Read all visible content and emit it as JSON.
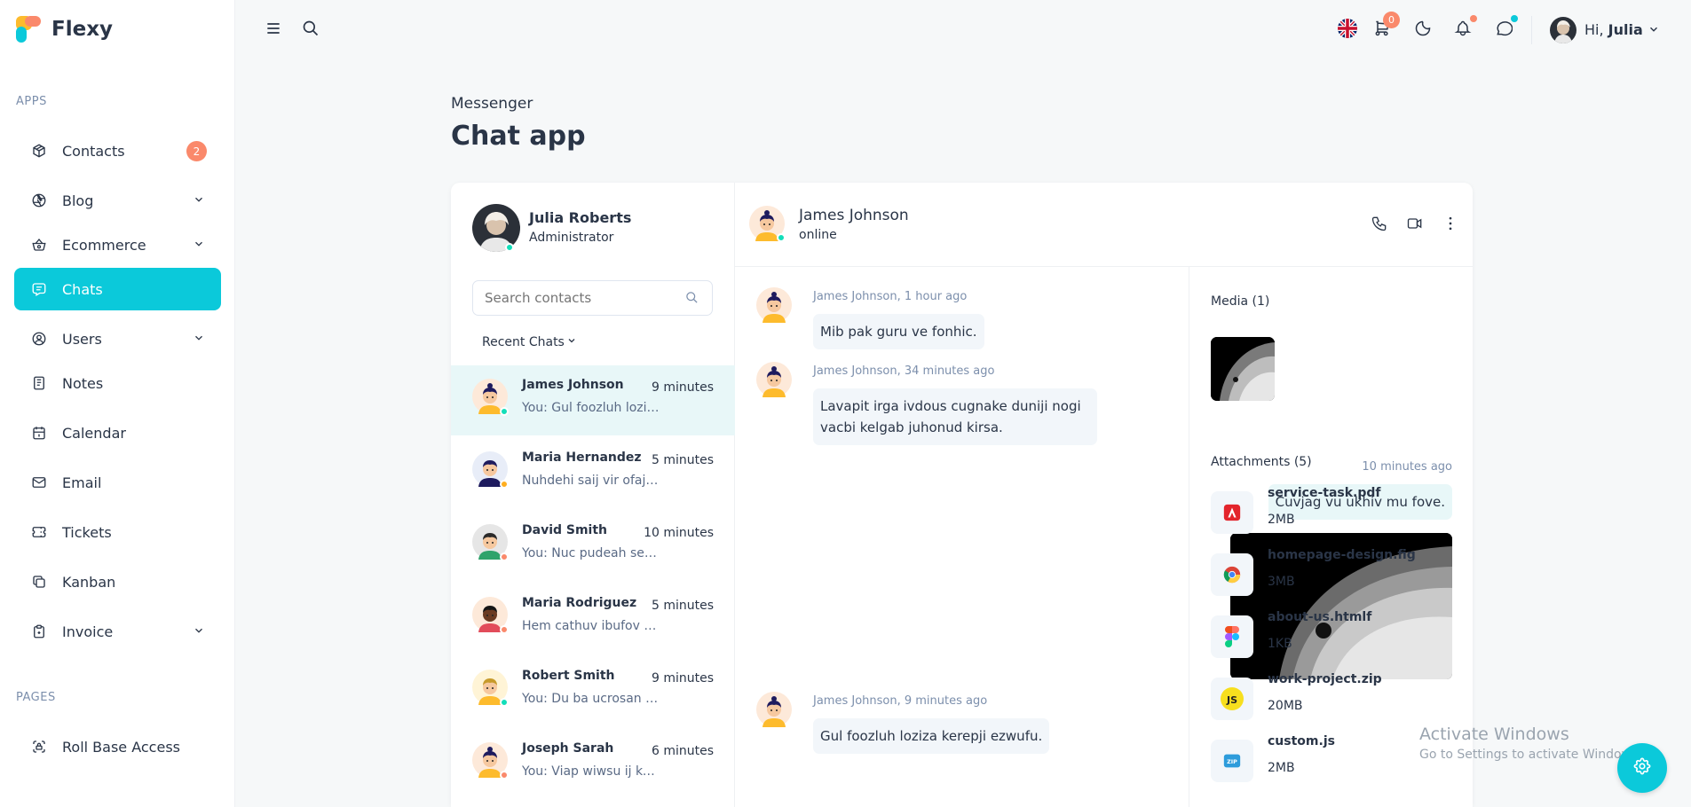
{
  "brand": {
    "name": "Flexy"
  },
  "sidebar": {
    "sections": [
      {
        "label": "APPS"
      },
      {
        "label": "PAGES"
      }
    ],
    "items": [
      {
        "label": "Contacts",
        "icon": "package-icon",
        "badge": "2"
      },
      {
        "label": "Blog",
        "icon": "aperture-icon",
        "expandable": true
      },
      {
        "label": "Ecommerce",
        "icon": "basket-icon",
        "expandable": true
      },
      {
        "label": "Chats",
        "icon": "message-icon",
        "active": true
      },
      {
        "label": "Users",
        "icon": "user-circle-icon",
        "expandable": true
      },
      {
        "label": "Notes",
        "icon": "notes-icon"
      },
      {
        "label": "Calendar",
        "icon": "calendar-icon"
      },
      {
        "label": "Email",
        "icon": "mail-icon"
      },
      {
        "label": "Tickets",
        "icon": "ticket-icon"
      },
      {
        "label": "Kanban",
        "icon": "copy-icon"
      },
      {
        "label": "Invoice",
        "icon": "clipboard-icon",
        "expandable": true
      },
      {
        "label": "Roll Base Access",
        "icon": "lock-access-icon"
      }
    ]
  },
  "header": {
    "cart_count": "0",
    "greeting": "Hi,",
    "user_first_name": "Julia"
  },
  "page": {
    "breadcrumb": "Messenger",
    "title": "Chat app"
  },
  "profile": {
    "name": "Julia Roberts",
    "role": "Administrator"
  },
  "search": {
    "placeholder": "Search contacts"
  },
  "recent_label": "Recent Chats",
  "contacts": [
    {
      "name": "James Johnson",
      "time": "9 minutes",
      "preview": "You: Gul foozluh loziza kerepji ezwufu.",
      "status_color": "#13deb9",
      "selected": true
    },
    {
      "name": "Maria Hernandez",
      "time": "5 minutes",
      "preview": "Nuhdehi saij vir ofajo ucowi.",
      "status_color": "#ffae1f"
    },
    {
      "name": "David Smith",
      "time": "10 minutes",
      "preview": "You: Nuc pudeah se tazkej.",
      "status_color": "#fa896b"
    },
    {
      "name": "Maria Rodriguez",
      "time": "5 minutes",
      "preview": "Hem cathuv ibufov sajom.",
      "status_color": "#fa896b"
    },
    {
      "name": "Robert Smith",
      "time": "9 minutes",
      "preview": "You: Du ba ucrosan dugzuw.",
      "status_color": "#13deb9"
    },
    {
      "name": "Joseph Sarah",
      "time": "6 minutes",
      "preview": "You: Viap wiwsu ij kugzus.",
      "status_color": "#fa896b"
    }
  ],
  "chat": {
    "name": "James Johnson",
    "status": "online",
    "messages": [
      {
        "meta": "James Johnson, 1 hour ago",
        "text": "Mib pak guru ve fonhic."
      },
      {
        "meta": "James Johnson, 34 minutes ago",
        "text_line1": "Lavapit irga ivdous cugnake duniji nogi",
        "text_line2": "vacbi kelgab juhonud kirsa."
      },
      {
        "meta": "10 minutes ago",
        "text": "Cuvjag vu ukhiv mu fove.",
        "mine": true
      },
      {
        "meta": "James Johnson, 9 minutes ago",
        "text": "Gul foozluh loziza kerepji ezwufu."
      }
    ]
  },
  "media": {
    "label": "Media (1)"
  },
  "attachments": {
    "label": "Attachments (5)",
    "files": [
      {
        "name": "service-task.pdf",
        "size": "2MB",
        "icon": "pdf-icon"
      },
      {
        "name": "homepage-design.fig",
        "size": "3MB",
        "icon": "chrome-icon"
      },
      {
        "name": "about-us.htmlf",
        "size": "1KB",
        "icon": "figma-icon"
      },
      {
        "name": "work-project.zip",
        "size": "20MB",
        "icon": "js-icon"
      },
      {
        "name": "custom.js",
        "size": "2MB",
        "icon": "zip-icon"
      }
    ]
  },
  "watermark": {
    "line1": "Activate Windows",
    "line2": "Go to Settings to activate Windows."
  },
  "colors": {
    "accent": "#0bc9da",
    "badge": "#fa896b",
    "success": "#13deb9",
    "warning": "#ffae1f"
  }
}
